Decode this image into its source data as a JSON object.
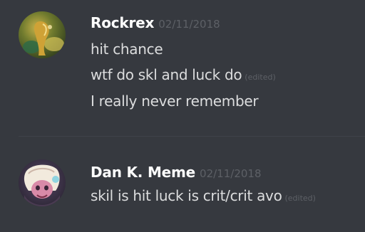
{
  "colors": {
    "background": "#36393f",
    "username": "#ffffff",
    "message_text": "#dcddde",
    "timestamp": "#5d6066",
    "divider": "#40434a"
  },
  "messages": [
    {
      "author": "Rockrex",
      "avatar_icon": "user-avatar-icon",
      "timestamp": "02/11/2018",
      "lines": [
        {
          "text": "hit chance",
          "edited": ""
        },
        {
          "text": "wtf do skl and luck do",
          "edited": "(edited)"
        },
        {
          "text": "I really never remember",
          "edited": ""
        }
      ]
    },
    {
      "author": "Dan K. Meme",
      "avatar_icon": "user-avatar-icon",
      "timestamp": "02/11/2018",
      "lines": [
        {
          "text": "skil is hit luck is crit/crit avo",
          "edited": "(edited)"
        }
      ]
    }
  ]
}
